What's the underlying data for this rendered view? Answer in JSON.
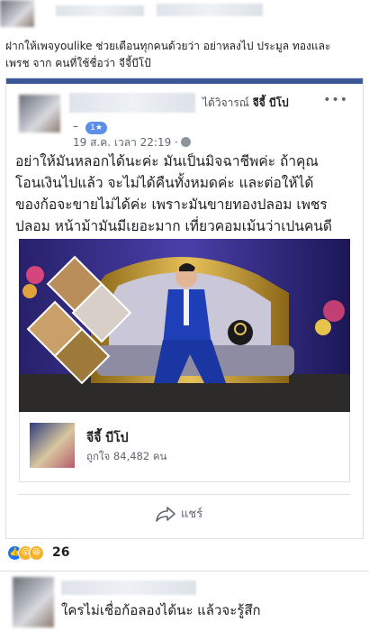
{
  "caption": {
    "line1": "ฝากให้เพจyoulike ช่วยเตือนทุกคนด้วยว่า อย่าหลงไป ประมูล ทองและ",
    "line2": "เพรช จาก คนที่ใช้ชื่อว่า จีจี้บีโป้"
  },
  "post": {
    "reviewed_prefix": "ได้วิจารณ์",
    "reviewed_page": "จีจี้ บีโป",
    "more_label": "•••",
    "dash": "–",
    "badge": "1★",
    "time": "19 ส.ค. เวลา 22:19 ·",
    "text_lines": [
      "อย่าให้มันหลอกได้นะค่ะ มันเป็นมิจฉาชีพค่ะ ถ้าคุณ",
      "โอนเงินไปแล้ว จะไม่ได้คืนทั้งหมดค่ะ และต่อให้ได้",
      "ของก้อจะขายไม่ได้ค่ะ เพราะมันขายทองปลอม เพชร",
      "ปลอม หน้าม้ามันมีเยอะมาก เที่ยวคอมเม้นว่าเปนคนดี"
    ]
  },
  "page_box": {
    "name": "จีจี้ บีโป",
    "likes": "ถูกใจ 84,482 คน"
  },
  "share": {
    "label": "แชร์"
  },
  "reactions": {
    "count": "26",
    "icons": [
      "like-icon",
      "wow-icon",
      "haha-icon"
    ]
  },
  "comment": {
    "text": "ใครไม่เชื่อก้อลองได้นะ แล้วจะรู้สึก"
  },
  "colors": {
    "fb_blue": "#3b5998",
    "badge_blue": "#5b8fe8",
    "text_secondary": "#606770",
    "like_blue": "#1877f2",
    "reaction_yellow": "#f7b125"
  }
}
